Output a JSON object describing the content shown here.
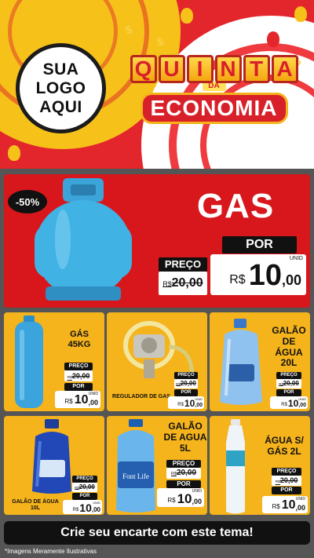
{
  "logo": {
    "line1": "SUA",
    "line2": "LOGO",
    "line3": "AQUI"
  },
  "title": {
    "quinta_letters": [
      "Q",
      "U",
      "I",
      "N",
      "T",
      "A"
    ],
    "da": "DA",
    "economia": "ECONOMIA"
  },
  "hero": {
    "badge": "-50%",
    "name": "GAS",
    "preco_label": "PREÇO",
    "old_currency": "R$",
    "old_value": "20,00",
    "por_label": "POR",
    "new_currency": "R$",
    "new_value_int": "10",
    "new_value_dec": ",00",
    "unit": "UNID"
  },
  "products": [
    {
      "name": "GÁS 45KG",
      "preco_label": "PREÇO",
      "old_currency": "R$",
      "old_value": "20,00",
      "por_label": "POR",
      "new_currency": "R$",
      "new_value_int": "10",
      "new_value_dec": ",00",
      "unit": "UNID"
    },
    {
      "name": "REGULADOR DE GAS",
      "preco_label": "PREÇO",
      "old_currency": "R$",
      "old_value": "20,00",
      "por_label": "POR",
      "new_currency": "R$",
      "new_value_int": "10",
      "new_value_dec": ",00",
      "unit": "UNID"
    },
    {
      "name": "GALÃO DE ÁGUA 20L",
      "preco_label": "PREÇO",
      "old_currency": "R$",
      "old_value": "20,00",
      "por_label": "POR",
      "new_currency": "R$",
      "new_value_int": "10",
      "new_value_dec": ",00",
      "unit": "UNID"
    },
    {
      "name": "GALÃO DE ÁGUA 10L",
      "preco_label": "PREÇO",
      "old_currency": "R$",
      "old_value": "20,00",
      "por_label": "POR",
      "new_currency": "R$",
      "new_value_int": "10",
      "new_value_dec": ",00",
      "unit": "UNID"
    },
    {
      "name": "GALÃO DE AGUA 5L",
      "preco_label": "PREÇO",
      "old_currency": "R$",
      "old_value": "20,00",
      "por_label": "POR",
      "new_currency": "R$",
      "new_value_int": "10",
      "new_value_dec": ",00",
      "unit": "UNID"
    },
    {
      "name": "ÁGUA S/ GÁS 2L",
      "preco_label": "PREÇO",
      "old_currency": "R$",
      "old_value": "20,00",
      "por_label": "POR",
      "new_currency": "R$",
      "new_value_int": "10",
      "new_value_dec": ",00",
      "unit": "UNID"
    }
  ],
  "images": {
    "bottle5l_brand": "Font Life"
  },
  "footer": {
    "cta": "Crie seu encarte com este tema!",
    "disclaimer": "*Imagens Meramente Ilustrativas"
  },
  "colors": {
    "brand_red": "#e3262b",
    "card_yellow": "#f5b31c",
    "accent_yellow": "#f6c21a",
    "dark": "#111111"
  }
}
